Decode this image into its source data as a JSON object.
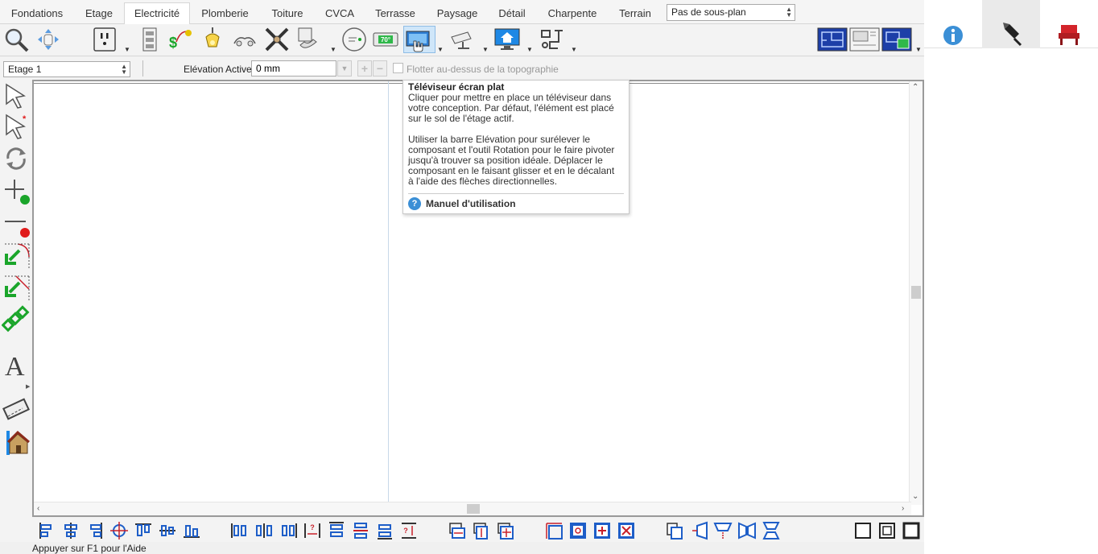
{
  "tabs": [
    {
      "label": "Fondations",
      "active": false
    },
    {
      "label": "Etage",
      "active": false
    },
    {
      "label": "Electricité",
      "active": true
    },
    {
      "label": "Plomberie",
      "active": false
    },
    {
      "label": "Toiture",
      "active": false
    },
    {
      "label": "CVCA",
      "active": false
    },
    {
      "label": "Terrasse",
      "active": false
    },
    {
      "label": "Paysage",
      "active": false
    },
    {
      "label": "Détail",
      "active": false
    },
    {
      "label": "Charpente",
      "active": false
    },
    {
      "label": "Terrain",
      "active": false
    }
  ],
  "subplan": {
    "value": "Pas de sous-plan"
  },
  "toolbar": {
    "thermostat_label": "70°"
  },
  "floorbar": {
    "floor_value": "Etage 1",
    "elevation_label": "Elévation Active:",
    "elevation_value": "0 mm",
    "float_label": "Flotter au-dessus de la topographie"
  },
  "tooltip": {
    "title": "Téléviseur écran plat",
    "para1": "Cliquer pour mettre en place un téléviseur dans\nvotre conception. Par défaut, l'élément est placé\nsur le sol de l'étage actif.",
    "para2": "Utiliser la barre Elévation pour surélever le\ncomposant et l'outil Rotation pour le faire pivoter\njusqu'à trouver sa position idéale. Déplacer le\ncomposant en le faisant glisser et en le décalant\nà l'aide des flèches directionnelles.",
    "help_label": "Manuel d'utilisation",
    "help_glyph": "?"
  },
  "left_tools": {
    "text_tool_glyph": "A"
  },
  "status": {
    "text": "Appuyer sur F1 pour l'Aide"
  },
  "colors": {
    "accent_blue": "#3b8fd6",
    "selected_bg": "#cfe6f9",
    "green": "#1aa52a",
    "red": "#e01b1b",
    "dark_red": "#c8202a"
  }
}
